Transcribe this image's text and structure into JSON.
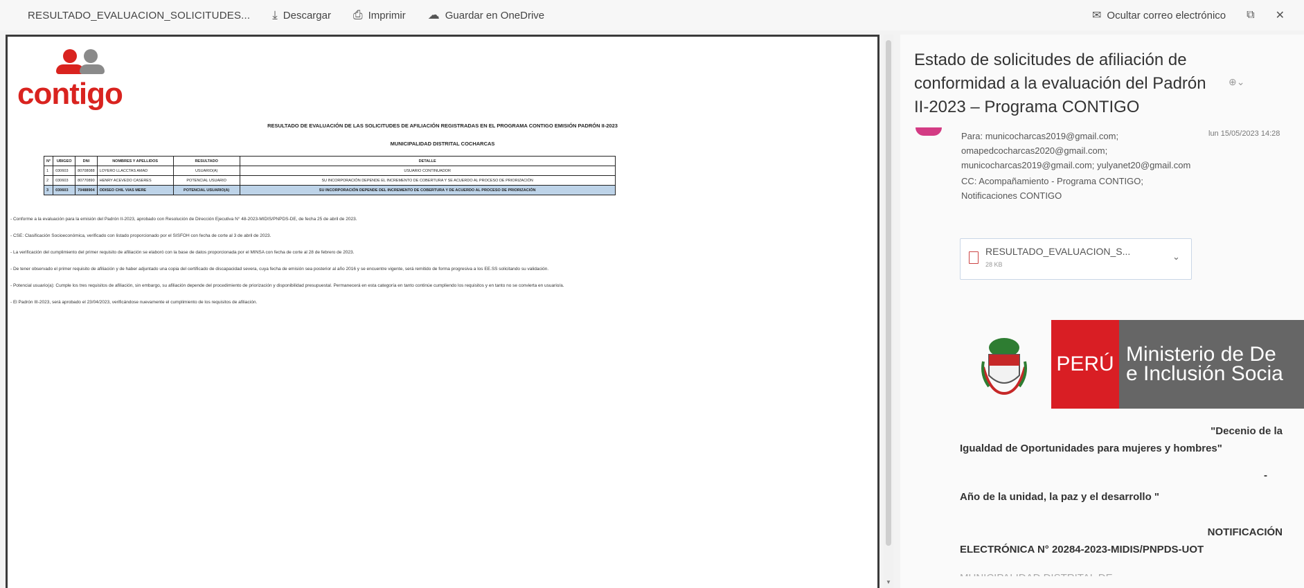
{
  "toolbar": {
    "filename": "RESULTADO_EVALUACION_SOLICITUDES...",
    "download": "Descargar",
    "print": "Imprimir",
    "save_onedrive": "Guardar en OneDrive",
    "hide_email": "Ocultar correo electrónico"
  },
  "document": {
    "logo_text": "contigo",
    "title": "RESULTADO DE EVALUACIÓN DE LAS SOLICITUDES DE AFILIACIÓN REGISTRADAS EN EL PROGRAMA CONTIGO EMISIÓN PADRÓN II-2023",
    "subtitle": "MUNICIPALIDAD DISTRITAL COCHARCAS",
    "table": {
      "headers": [
        "N°",
        "UBIGEO",
        "DNI",
        "NOMBRES Y APELLIDOS",
        "RESULTADO",
        "DETALLE"
      ],
      "rows": [
        [
          "1",
          "030603",
          "80708088",
          "LOYERO LLACCTAS AMAD",
          "USUARIO(A)",
          "USUARIO CONTINUADOR"
        ],
        [
          "2",
          "030603",
          "80770890",
          "HENRY ACEVEDO CASERES",
          "POTENCIAL USUARIO",
          "SU INCORPORACIÓN DEPENDE EL INCREMENTO DE COBERTURA Y SE ACUERDO AL PROCESO DE PRIORIZACIÓN"
        ],
        [
          "3",
          "030603",
          "70488904",
          "ODISEO CHIL VIAS MERE",
          "POTENCIAL USUARIO(A)",
          "SU INCORPORACIÓN DEPENDE DEL INCREMENTO DE COBERTURA Y DE ACUERDO AL PROCESO DE PRIORIZACIÓN"
        ]
      ]
    },
    "notes": [
      "- Conforme a la evaluación para la emisión del Padrón II-2023, aprobado con Resolución de Dirección Ejecutiva N° 48-2023-MIDIS/PNPDS-DE, de fecha 25 de abril de 2023.",
      "- CSE: Clasificación Socioeconómica, verificado con listado proporcionado por el SISFOH con fecha de corte al 3 de abril de 2023.",
      "- La verificación del cumplimiento del primer requisito de afiliación se elaboró con la base de datos proporcionada por el MINSA con fecha de corte al 28 de febrero de 2023.",
      "- De tener observado el primer requisito de afiliación y de haber adjuntado una copia del certificado de discapacidad severa, cuya fecha de emisión sea posterior al año 2016 y se encuentre vigente, será remitido de forma progresiva a los EE.SS solicitando su validación.",
      "- Potencial usuario(a): Cumple los tres requisitos de afiliación, sin embargo, su afiliación depende del procedimiento de priorización y disponibilidad presupuestal. Permanecerá en esta categoría en tanto continúe cumpliendo los requisitos y en tanto no se convierta en usuario/a.",
      "- El Padrón III-2023, será aprobado el 23/04/2023, verificándose nuevamente el cumplimiento de los requisitos de afiliación."
    ]
  },
  "email": {
    "subject": "Estado de solicitudes de afiliación de conformidad a la evaluación del Padrón II-2023 – Programa CONTIGO",
    "to_label": "Para:",
    "to": "municocharcas2019@gmail.com; omapedcocharcas2020@gmail.com; municocharcas2019@gmail.com; yulyanet20@gmail.com",
    "cc_label": "CC:",
    "cc": "Acompañamiento - Programa CONTIGO; Notificaciones CONTIGO",
    "date": "lun 15/05/2023 14:28",
    "attachment_name": "RESULTADO_EVALUACION_S...",
    "attachment_size": "28 KB",
    "banner_peru": "PERÚ",
    "banner_ministry_1": "Ministerio de De",
    "banner_ministry_2": "e Inclusión Socia",
    "body_1a": "\"Decenio de la",
    "body_1b": "Igualdad de Oportunidades para mujeres y hombres\"",
    "body_dash": "-",
    "body_2": "Año de la unidad, la paz y el desarrollo \"",
    "body_3a": "NOTIFICACIÓN",
    "body_3b": "ELECTRÓNICA N° 20284-2023-MIDIS/PNPDS-UOT",
    "body_4": "MUNICIPALIDAD DISTRITAL DE"
  }
}
